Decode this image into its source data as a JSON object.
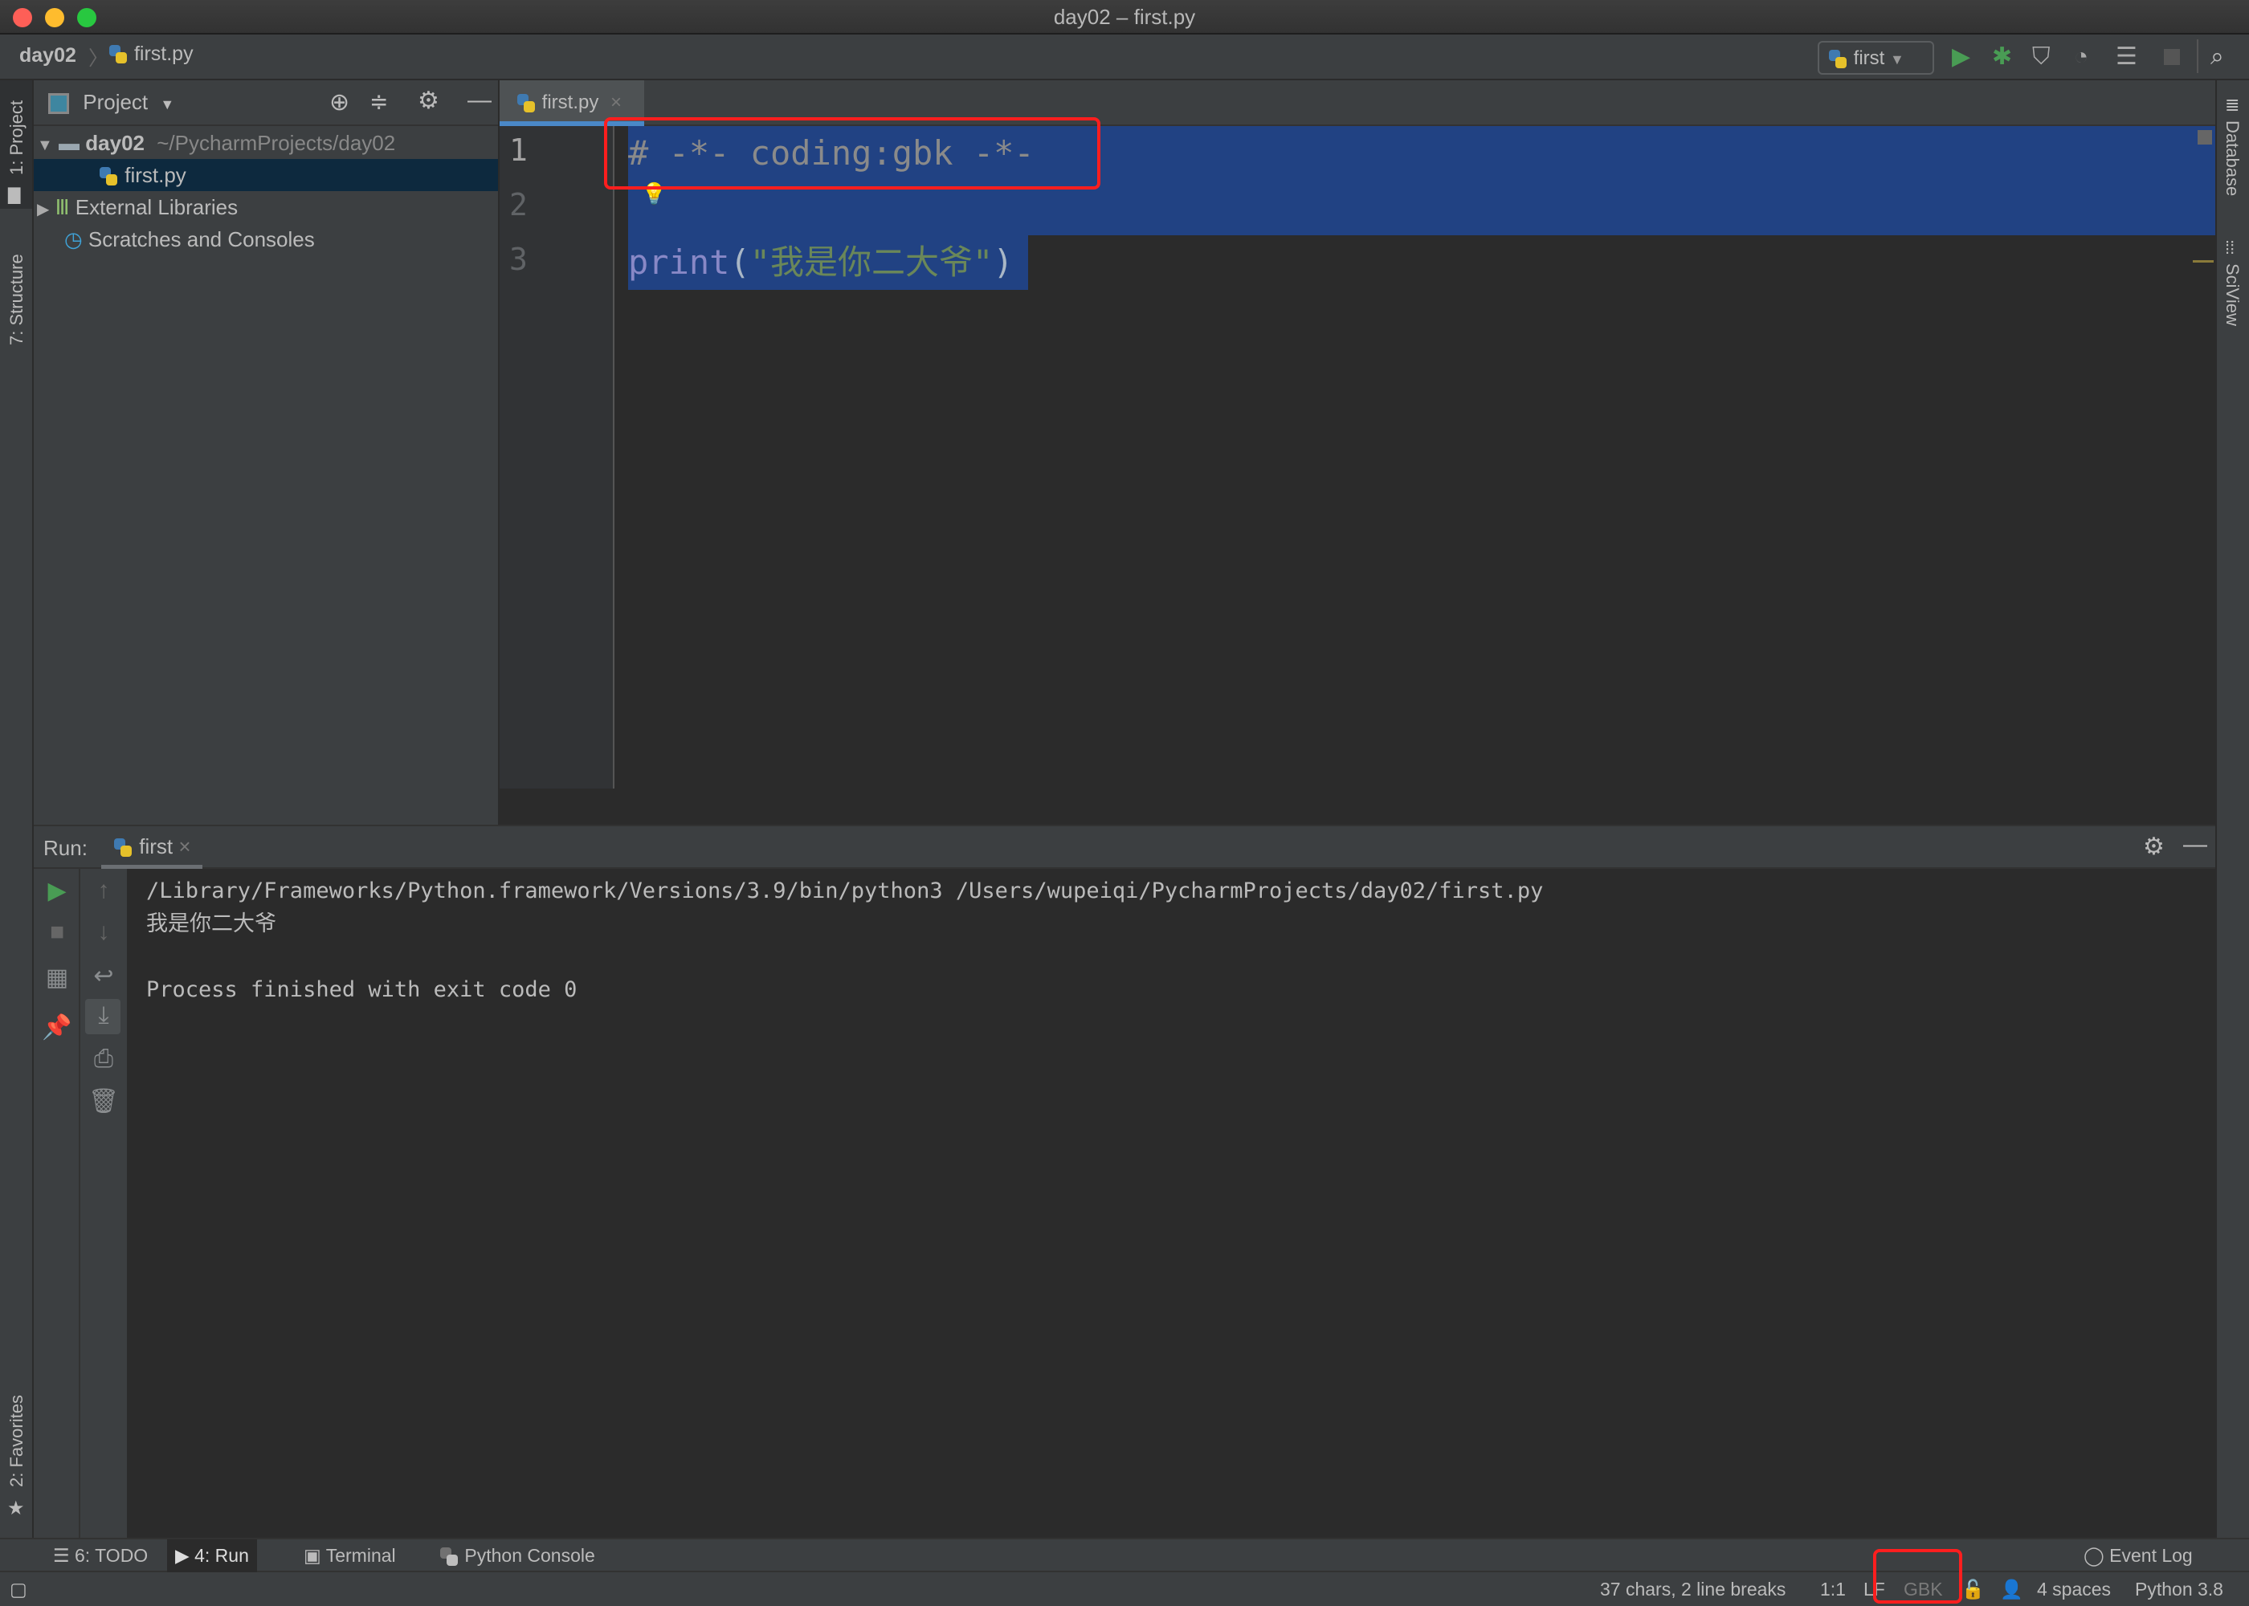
{
  "window": {
    "title": "day02 – first.py"
  },
  "navbar": {
    "breadcrumb": [
      "day02",
      "first.py"
    ],
    "run_config": "first",
    "icons": [
      "run-icon",
      "debug-icon",
      "coverage-icon",
      "profile-icon",
      "concurrency-icon",
      "stop-icon",
      "search-icon"
    ]
  },
  "left_stripe": {
    "project": "1: Project",
    "structure": "7: Structure",
    "favorites": "2: Favorites"
  },
  "right_stripe": {
    "database": "Database",
    "sciview": "SciView"
  },
  "project": {
    "header": "Project",
    "root": {
      "name": "day02",
      "path": "~/PycharmProjects/day02"
    },
    "file": "first.py",
    "external": "External Libraries",
    "scratches": "Scratches and Consoles"
  },
  "editor": {
    "tab": "first.py",
    "line_numbers": [
      "1",
      "2",
      "3"
    ],
    "line1": "# -*- coding:gbk -*-",
    "line3_fn": "print",
    "line3_open": "(",
    "line3_str": "\"我是你二大爷\"",
    "line3_close": ")"
  },
  "run": {
    "label": "Run:",
    "tab": "first",
    "output": [
      "/Library/Frameworks/Python.framework/Versions/3.9/bin/python3 /Users/wupeiqi/PycharmProjects/day02/first.py",
      "我是你二大爷",
      "",
      "Process finished with exit code 0"
    ]
  },
  "bottom_tabs": {
    "todo": "6: TODO",
    "run": "4: Run",
    "terminal": "Terminal",
    "python_console": "Python Console",
    "event_log": "Event Log"
  },
  "status": {
    "chars": "37 chars, 2 line breaks",
    "position": "1:1",
    "line_sep": "LF",
    "encoding": "GBK",
    "indent": "4 spaces",
    "interpreter": "Python 3.8"
  },
  "colors": {
    "selection": "#214283",
    "highlight_box": "#ff1e1e",
    "run_green": "#499c54",
    "keyword": "#8888c6",
    "string": "#6a8759",
    "comment": "#808080"
  }
}
